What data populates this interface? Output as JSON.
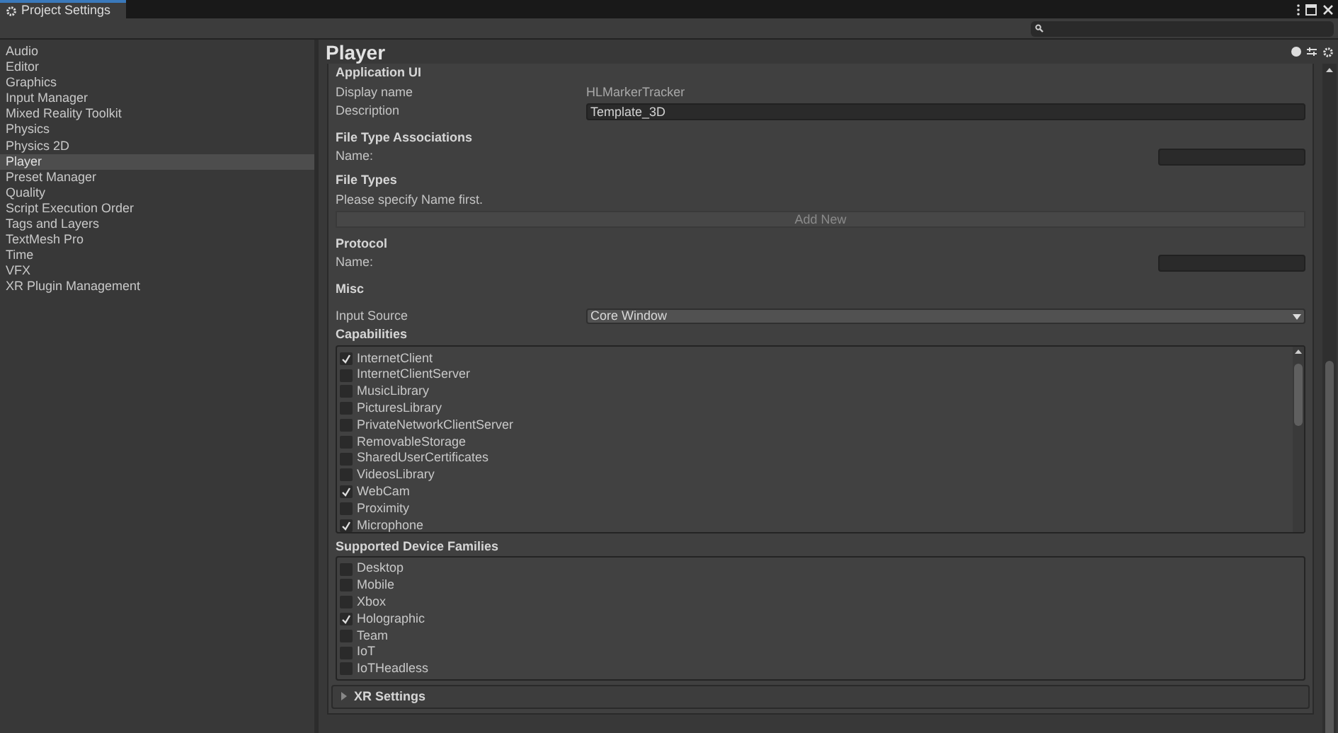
{
  "window": {
    "tab_title": "Project Settings"
  },
  "sidebar": {
    "items": [
      {
        "label": "Audio",
        "selected": false
      },
      {
        "label": "Editor",
        "selected": false
      },
      {
        "label": "Graphics",
        "selected": false
      },
      {
        "label": "Input Manager",
        "selected": false
      },
      {
        "label": "Mixed Reality Toolkit",
        "selected": false
      },
      {
        "label": "Physics",
        "selected": false
      },
      {
        "label": "Physics 2D",
        "selected": false
      },
      {
        "label": "Player",
        "selected": true
      },
      {
        "label": "Preset Manager",
        "selected": false
      },
      {
        "label": "Quality",
        "selected": false
      },
      {
        "label": "Script Execution Order",
        "selected": false
      },
      {
        "label": "Tags and Layers",
        "selected": false
      },
      {
        "label": "TextMesh Pro",
        "selected": false
      },
      {
        "label": "Time",
        "selected": false
      },
      {
        "label": "VFX",
        "selected": false
      },
      {
        "label": "XR Plugin Management",
        "selected": false
      }
    ]
  },
  "inspector": {
    "title": "Player",
    "application_ui": {
      "heading": "Application UI",
      "display_name_label": "Display name",
      "display_name_value": "HLMarkerTracker",
      "description_label": "Description",
      "description_value": "Template_3D"
    },
    "file_type_associations": {
      "heading": "File Type Associations",
      "name_label": "Name:"
    },
    "file_types": {
      "heading": "File Types",
      "message": "Please specify Name first.",
      "add_button": "Add New"
    },
    "protocol": {
      "heading": "Protocol",
      "name_label": "Name:"
    },
    "misc": {
      "heading": "Misc",
      "input_source_label": "Input Source",
      "input_source_value": "Core Window"
    },
    "capabilities": {
      "heading": "Capabilities",
      "items": [
        {
          "label": "InternetClient",
          "checked": true
        },
        {
          "label": "InternetClientServer",
          "checked": false
        },
        {
          "label": "MusicLibrary",
          "checked": false
        },
        {
          "label": "PicturesLibrary",
          "checked": false
        },
        {
          "label": "PrivateNetworkClientServer",
          "checked": false
        },
        {
          "label": "RemovableStorage",
          "checked": false
        },
        {
          "label": "SharedUserCertificates",
          "checked": false
        },
        {
          "label": "VideosLibrary",
          "checked": false
        },
        {
          "label": "WebCam",
          "checked": true
        },
        {
          "label": "Proximity",
          "checked": false
        },
        {
          "label": "Microphone",
          "checked": true
        }
      ]
    },
    "device_families": {
      "heading": "Supported Device Families",
      "items": [
        {
          "label": "Desktop",
          "checked": false
        },
        {
          "label": "Mobile",
          "checked": false
        },
        {
          "label": "Xbox",
          "checked": false
        },
        {
          "label": "Holographic",
          "checked": true
        },
        {
          "label": "Team",
          "checked": false
        },
        {
          "label": "IoT",
          "checked": false
        },
        {
          "label": "IoTHeadless",
          "checked": false
        }
      ]
    },
    "xr_settings": {
      "label": "XR Settings",
      "expanded": false
    }
  }
}
